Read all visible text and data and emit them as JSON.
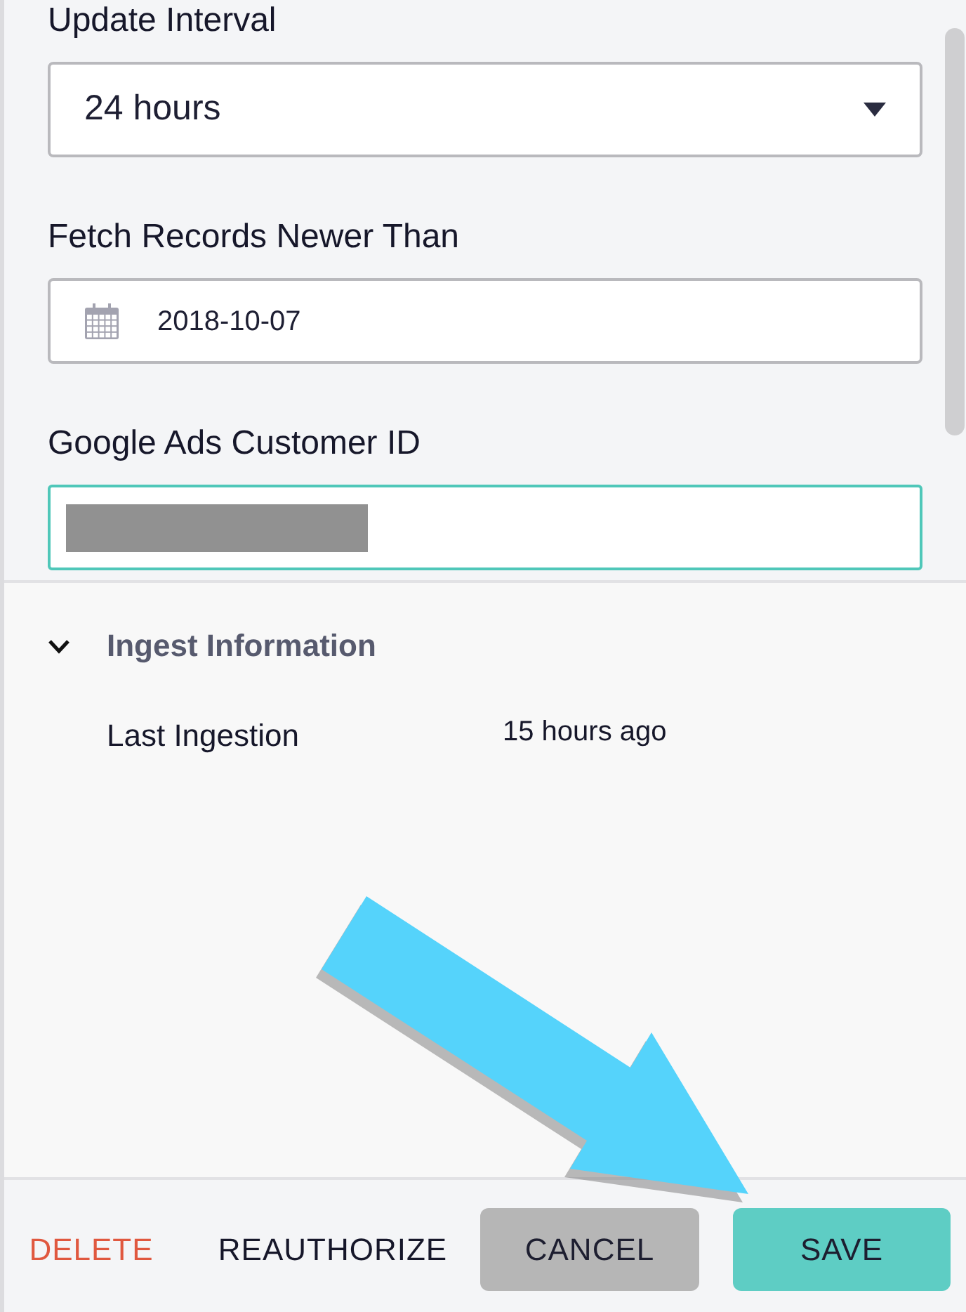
{
  "fields": [
    {
      "kind": "select",
      "label": "Update Interval",
      "value": "24 hours",
      "focused": false
    },
    {
      "kind": "date",
      "label": "Fetch Records Newer Than",
      "value": "2018-10-07",
      "focused": false
    },
    {
      "kind": "text",
      "label": "Google Ads Customer ID",
      "redacted": true,
      "focused": true
    }
  ],
  "section": {
    "title": "Ingest Information",
    "expanded": true,
    "rows": [
      {
        "label": "Last Ingestion",
        "value": "15 hours ago"
      }
    ]
  },
  "buttons": [
    {
      "label": "DELETE",
      "kind": "danger"
    },
    {
      "label": "REAUTHORIZE",
      "kind": "text"
    },
    {
      "label": "CANCEL",
      "kind": "secondary"
    },
    {
      "label": "SAVE",
      "kind": "primary"
    }
  ]
}
